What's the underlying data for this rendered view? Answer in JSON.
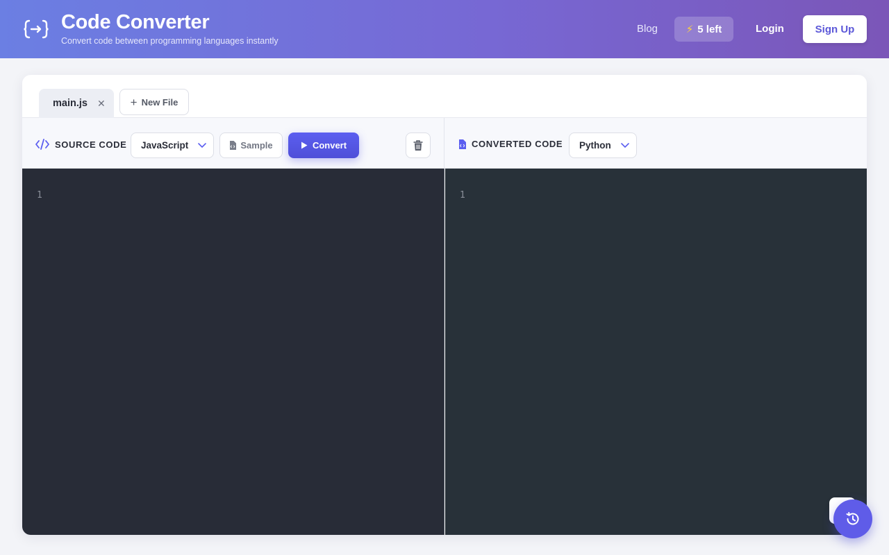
{
  "header": {
    "title": "Code Converter",
    "subtitle": "Convert code between programming languages instantly",
    "nav": {
      "blog": "Blog",
      "credits": "5 left",
      "login": "Login",
      "signup": "Sign Up"
    }
  },
  "tabs": {
    "file": "main.js",
    "new_file": "New File"
  },
  "source": {
    "label": "SOURCE CODE",
    "language": "JavaScript",
    "sample": "Sample",
    "convert": "Convert",
    "line_numbers": [
      "1"
    ]
  },
  "target": {
    "label": "CONVERTED CODE",
    "language": "Python",
    "line_numbers": [
      "1"
    ]
  },
  "colors": {
    "accent": "#5b5ef0",
    "source_editor_bg": "#282c37",
    "target_editor_bg": "#283139"
  },
  "icons": [
    "code-arrow-logo-icon",
    "lightning-icon",
    "plus-icon",
    "code-icon",
    "file-code-icon",
    "chevron-down-icon",
    "play-icon",
    "trash-icon",
    "history-icon",
    "close-icon"
  ]
}
